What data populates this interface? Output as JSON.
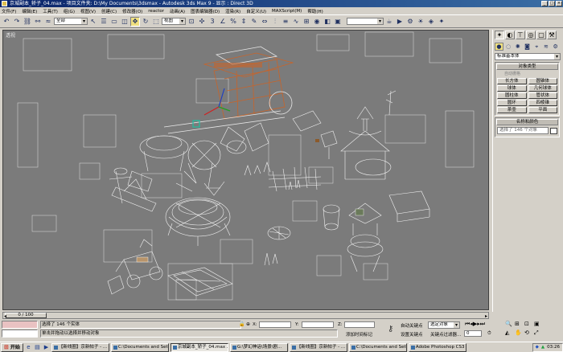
{
  "window": {
    "title": "京城副本_轿子_04.max   - 项目文件夹: D:\\My Documents\\3dsmax   - Autodesk 3ds Max 9   - 显示 : Direct 3D"
  },
  "menubar": {
    "items": [
      "文件(F)",
      "编辑(E)",
      "工具(T)",
      "组(G)",
      "视图(V)",
      "创建(C)",
      "修改器(O)",
      "reactor",
      "动画(A)",
      "图表编辑器(D)",
      "渲染(R)",
      "自定义(U)",
      "MAXScript(M)",
      "帮助(H)"
    ]
  },
  "toolbar": {
    "selection_filter": "全部",
    "coord_system": "视图"
  },
  "viewport": {
    "label": "透视"
  },
  "command_panel": {
    "category_dropdown": "标准基本体",
    "object_type_header": "对象类型",
    "autogrid_label": "自动栅格",
    "primitives": [
      "长方体",
      "圆锥体",
      "球体",
      "几何球体",
      "圆柱体",
      "管状体",
      "圆环",
      "四棱锥",
      "茶壶",
      "平面"
    ],
    "name_color_header": "名称和颜色",
    "name_field": "选择了 146 个对象"
  },
  "timeline": {
    "frame_display": "0 / 100"
  },
  "status": {
    "selection_info": "选择了 146 个实体",
    "prompt": "单击并拖动以选择并移动对象",
    "x_label": "X:",
    "y_label": "Y:",
    "z_label": "Z:",
    "grid_label": "栅格 = 10.0",
    "add_time_tag": "添加时间标记",
    "autokey_label": "自动关键点",
    "selected_option": "选定对象",
    "setkey_label": "设置关键点",
    "key_filters": "关键点过滤器...",
    "frame_value": "0"
  },
  "taskbar": {
    "start": "开始",
    "tasks": [
      "【新线圈】京新帖子 - ...",
      "C:\\Documents and Setti...",
      "京城副本_轿子_04.max ...",
      "G:\\梦幻神话\\场景\\剧...",
      "【新线圈】京新帖子 - ...",
      "C:\\Documents and Setti...",
      "Adobe Photoshop CS3 E..."
    ],
    "clock": "03:26"
  },
  "colors": {
    "title_start": "#0a246a",
    "title_end": "#3a6ea5",
    "viewport_bg": "#7b7b7b",
    "wire_white": "#f2f2f2",
    "selection_orange": "#c8642a"
  }
}
